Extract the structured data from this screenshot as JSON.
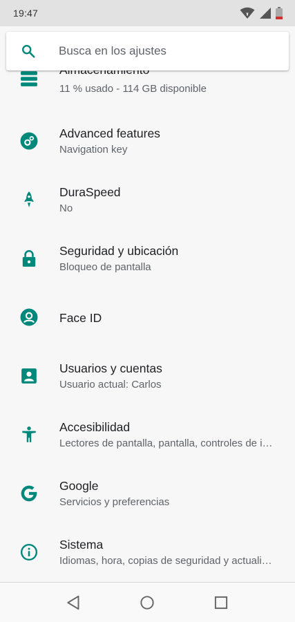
{
  "status_bar": {
    "time": "19:47"
  },
  "search": {
    "placeholder": "Busca en los ajustes"
  },
  "items": [
    {
      "title": "Almacenamiento",
      "subtitle": "11 % usado - 114 GB disponible",
      "icon": "storage-icon"
    },
    {
      "title": "Advanced features",
      "subtitle": "Navigation key",
      "icon": "advanced-features-icon"
    },
    {
      "title": "DuraSpeed",
      "subtitle": "No",
      "icon": "rocket-icon"
    },
    {
      "title": "Seguridad y ubicación",
      "subtitle": "Bloqueo de pantalla",
      "icon": "lock-icon"
    },
    {
      "title": "Face ID",
      "subtitle": "",
      "icon": "face-id-icon"
    },
    {
      "title": "Usuarios y cuentas",
      "subtitle": "Usuario actual: Carlos",
      "icon": "account-box-icon"
    },
    {
      "title": "Accesibilidad",
      "subtitle": "Lectores de pantalla, pantalla, controles de interacción",
      "icon": "accessibility-icon"
    },
    {
      "title": "Google",
      "subtitle": "Servicios y preferencias",
      "icon": "google-icon"
    },
    {
      "title": "Sistema",
      "subtitle": "Idiomas, hora, copias de seguridad y actualizaciones",
      "icon": "info-icon"
    }
  ],
  "colors": {
    "accent": "#00897b",
    "background": "#f7f7f7",
    "status_bar": "#e2e2e2",
    "battery_low": "#d32f2f"
  }
}
